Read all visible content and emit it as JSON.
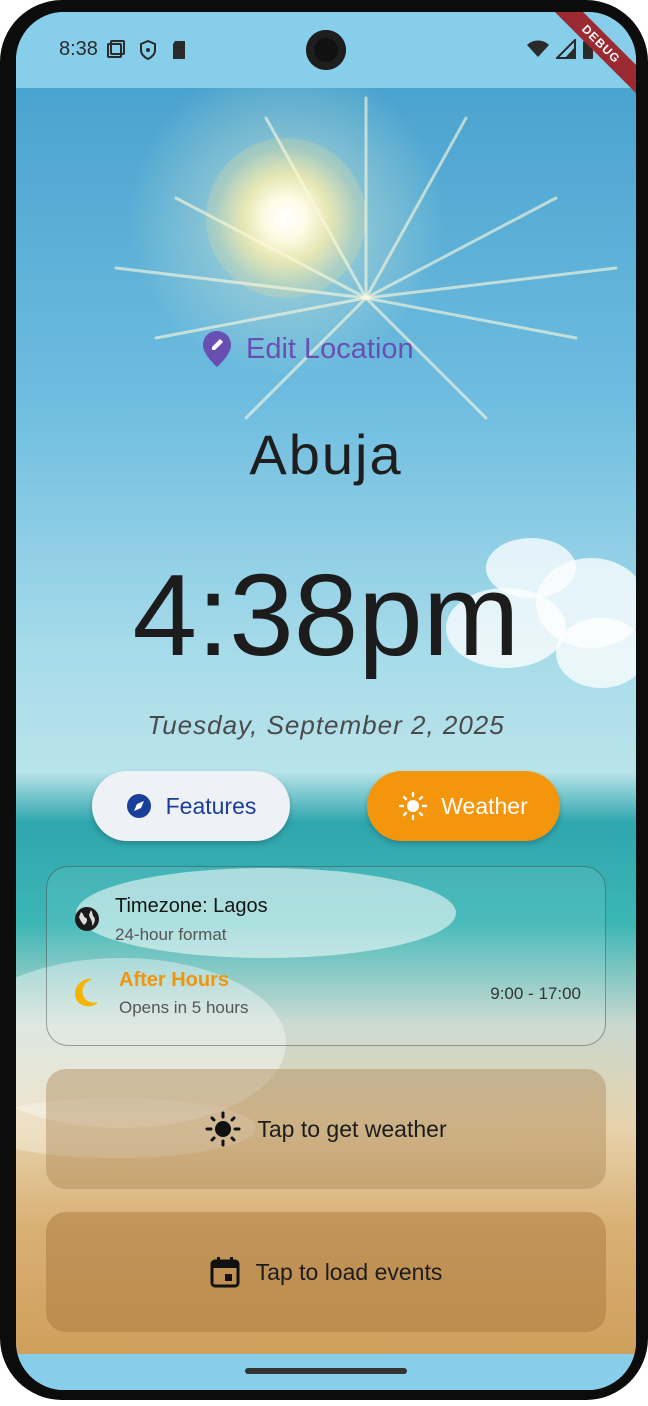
{
  "status_bar": {
    "time": "8:38",
    "debug_banner": "DEBUG"
  },
  "location": {
    "edit_label": "Edit Location",
    "city": "Abuja"
  },
  "clock": {
    "time": "4:38pm",
    "date": "Tuesday, September 2, 2025"
  },
  "buttons": {
    "features": "Features",
    "weather": "Weather"
  },
  "info": {
    "timezone_title": "Timezone: Lagos",
    "timezone_sub": "24-hour format",
    "status_title": "After Hours",
    "status_sub": "Opens in 5 hours",
    "hours": "9:00 - 17:00"
  },
  "actions": {
    "weather": "Tap to get weather",
    "events": "Tap to load events"
  },
  "colors": {
    "status_bar": "#87ceeb",
    "accent_purple": "#6a4fb3",
    "features_text": "#1a3f9a",
    "weather_orange": "#f4960c",
    "after_hours": "#f0960e"
  },
  "icons": {
    "edit_location": "location-pin-edit-icon",
    "features": "compass-icon",
    "weather": "sun-icon",
    "timezone": "globe-icon",
    "after_hours": "moon-icon",
    "weather_action": "sun-icon",
    "events_action": "calendar-icon"
  }
}
